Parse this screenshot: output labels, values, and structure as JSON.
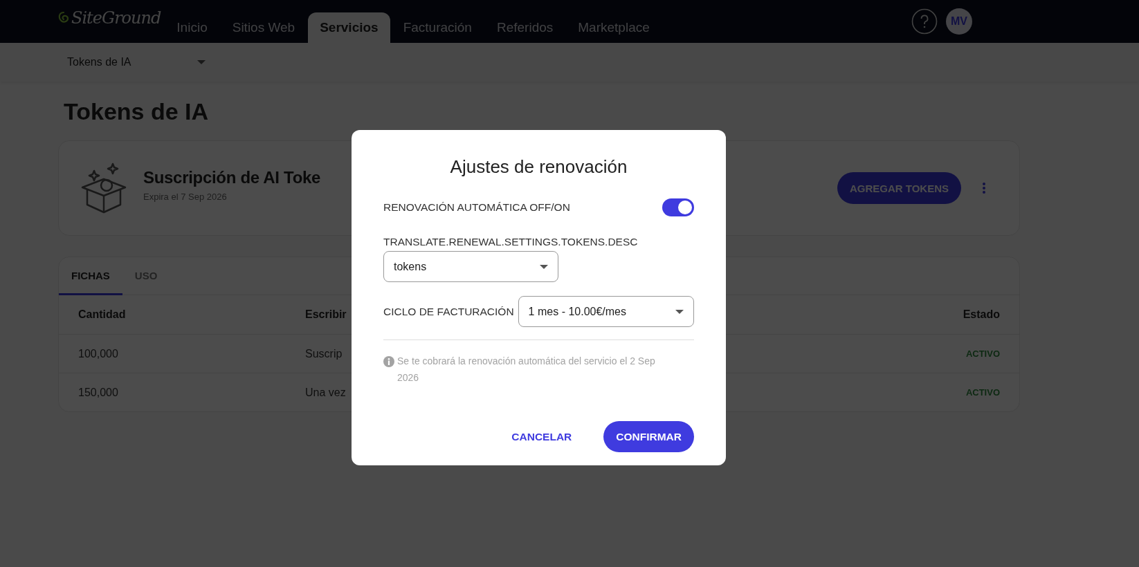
{
  "header": {
    "logo": "SiteGround",
    "nav": [
      {
        "label": "Inicio",
        "selected": false
      },
      {
        "label": "Sitios Web",
        "selected": false
      },
      {
        "label": "Servicios",
        "selected": true
      },
      {
        "label": "Facturación",
        "selected": false
      },
      {
        "label": "Referidos",
        "selected": false
      },
      {
        "label": "Marketplace",
        "selected": false
      }
    ],
    "avatar": "MV"
  },
  "subbar": {
    "dropdown": "Tokens de IA"
  },
  "page_title": "Tokens de IA",
  "subscription": {
    "title": "Suscripción de AI Toke",
    "expiry": "Expira el 7 Sep 2026",
    "button": "AGREGAR TOKENS"
  },
  "tokens_table": {
    "tabs": [
      {
        "label": "FICHAS",
        "selected": true
      },
      {
        "label": "USO",
        "selected": false
      }
    ],
    "columns": [
      "Cantidad",
      "Escribir",
      "Estado"
    ],
    "rows": [
      {
        "cells": [
          "100,000",
          "Suscrip",
          "ACTIVO"
        ]
      },
      {
        "cells": [
          "150,000",
          "Una vez",
          "ACTIVO"
        ]
      }
    ]
  },
  "modal": {
    "title": "Ajustes de renovación",
    "auto_renew": {
      "label": "RENOVACIÓN AUTOMÁTICA OFF/ON",
      "on": true
    },
    "tokens_field": {
      "label": "TRANSLATE.RENEWAL.SETTINGS.TOKENS.DESC",
      "value": "tokens"
    },
    "billing_cycle": {
      "label": "CICLO DE FACTURACIÓN",
      "value": "1 mes - 10.00€/mes"
    },
    "note": "Se te cobrará la renovación automática del servicio el 2 Sep 2026",
    "buttons": [
      {
        "label": "CANCELAR",
        "kind": "text"
      },
      {
        "label": "CONFIRMAR",
        "kind": "primary"
      }
    ]
  }
}
